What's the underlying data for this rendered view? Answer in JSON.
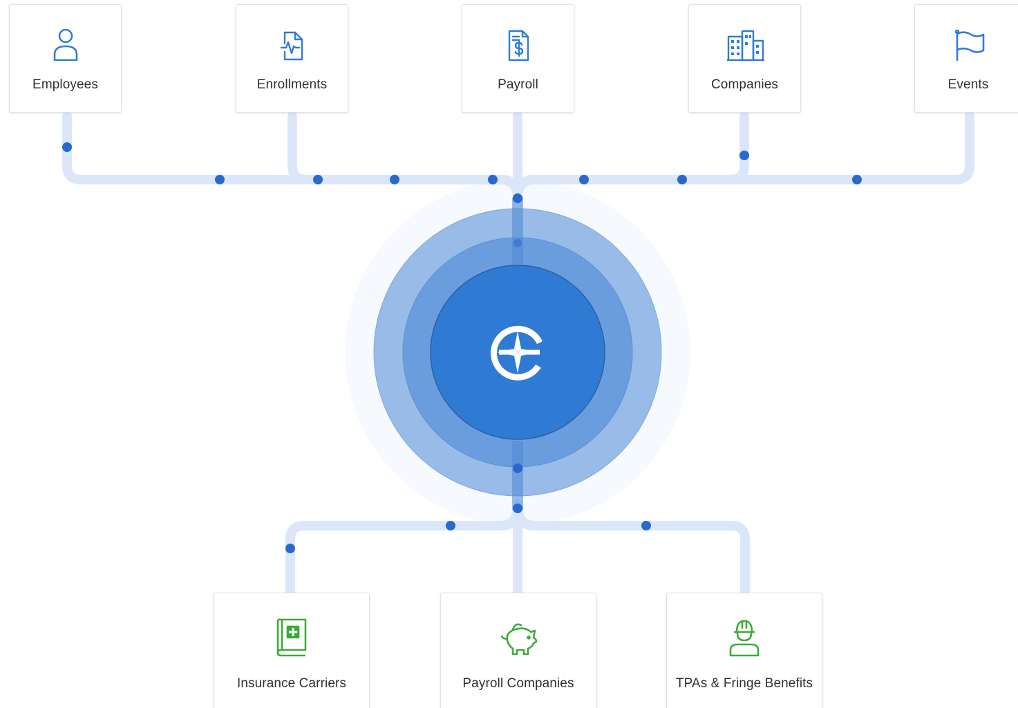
{
  "sources": [
    {
      "label": "Employees",
      "icon": "person-icon"
    },
    {
      "label": "Enrollments",
      "icon": "document-pulse-icon"
    },
    {
      "label": "Payroll",
      "icon": "invoice-dollar-icon"
    },
    {
      "label": "Companies",
      "icon": "buildings-icon"
    },
    {
      "label": "Events",
      "icon": "flag-icon"
    }
  ],
  "destinations": [
    {
      "label": "Insurance Carriers",
      "icon": "medical-book-icon"
    },
    {
      "label": "Payroll Companies",
      "icon": "piggy-bank-icon"
    },
    {
      "label": "TPAs & Fringe Benefits",
      "icon": "hard-hat-worker-icon"
    }
  ],
  "hub": {
    "logo": "compass-e-logo-icon"
  },
  "colors": {
    "source_icon": "#2f7bd9",
    "destination_icon": "#3aab3a",
    "hub_core": "#2f7bd4",
    "hub_ring_middle": "#6a9ddd",
    "hub_ring_outer": "#98bbe8",
    "flow_line": "#dbe7f8",
    "flow_dot": "#2869d0",
    "label_text": "#2c2f33"
  }
}
